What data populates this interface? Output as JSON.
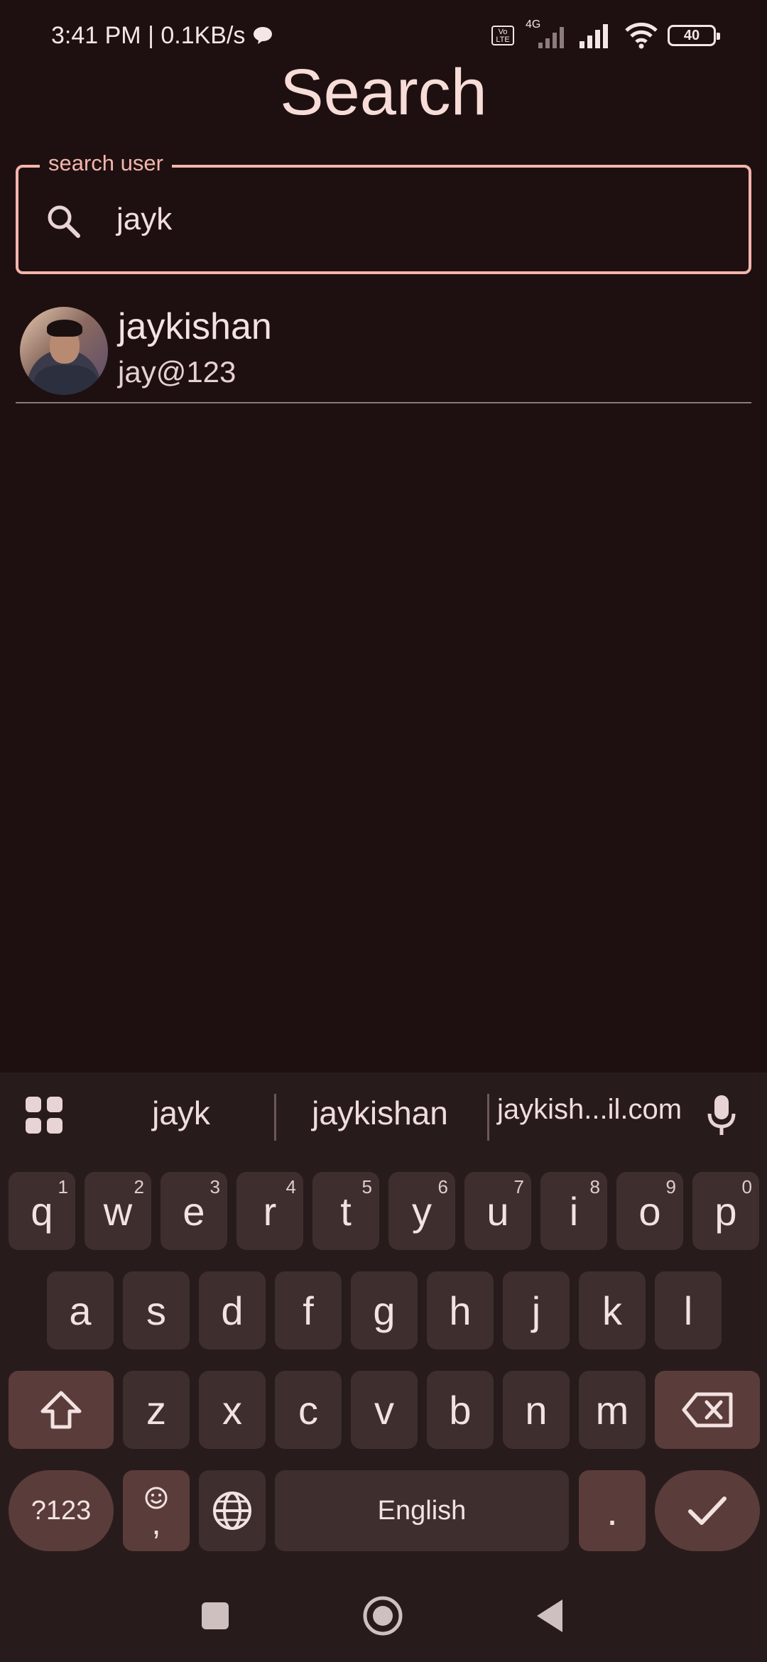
{
  "status_bar": {
    "time_speed": "3:41 PM | 0.1KB/s",
    "network_type": "4G",
    "volte_label": "Vo LTE",
    "battery": "40"
  },
  "page": {
    "title": "Search"
  },
  "search": {
    "legend": "search user",
    "value": "jayk"
  },
  "results": [
    {
      "name": "jaykishan",
      "handle": "jay@123"
    }
  ],
  "keyboard": {
    "suggestions": [
      "jayk",
      "jaykishan",
      "jaykish...il.com"
    ],
    "row1": [
      {
        "key": "q",
        "hint": "1"
      },
      {
        "key": "w",
        "hint": "2"
      },
      {
        "key": "e",
        "hint": "3"
      },
      {
        "key": "r",
        "hint": "4"
      },
      {
        "key": "t",
        "hint": "5"
      },
      {
        "key": "y",
        "hint": "6"
      },
      {
        "key": "u",
        "hint": "7"
      },
      {
        "key": "i",
        "hint": "8"
      },
      {
        "key": "o",
        "hint": "9"
      },
      {
        "key": "p",
        "hint": "0"
      }
    ],
    "row2": [
      "a",
      "s",
      "d",
      "f",
      "g",
      "h",
      "j",
      "k",
      "l"
    ],
    "row3": [
      "z",
      "x",
      "c",
      "v",
      "b",
      "n",
      "m"
    ],
    "symbols_label": "?123",
    "comma_label": ",",
    "space_label": "English",
    "period_label": "."
  }
}
